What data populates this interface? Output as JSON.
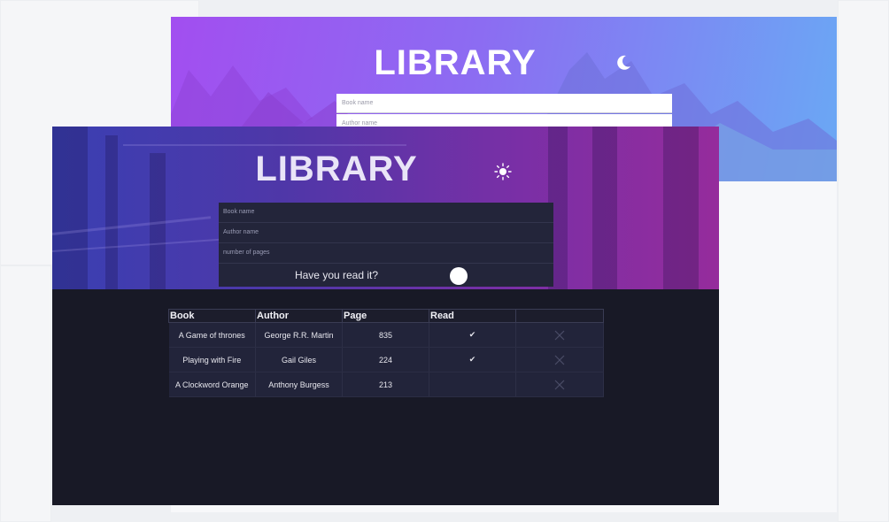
{
  "back_window": {
    "title": "LIBRARY",
    "theme_icon": "moon-icon",
    "fields": {
      "book_placeholder": "Book name",
      "author_placeholder": "Author name"
    }
  },
  "front_window": {
    "title": "LIBRARY",
    "theme_icon": "sun-icon",
    "form": {
      "book_placeholder": "Book name",
      "author_placeholder": "Author name",
      "pages_placeholder": "number of pages",
      "read_label": "Have you read it?"
    },
    "table": {
      "headers": [
        "Book",
        "Author",
        "Page",
        "Read",
        ""
      ],
      "rows": [
        {
          "book": "A Game of thrones",
          "author": "George R.R. Martin",
          "pages": "835",
          "read": "✔"
        },
        {
          "book": "Playing with Fire",
          "author": "Gail Giles",
          "pages": "224",
          "read": "✔"
        },
        {
          "book": "A Clockword Orange",
          "author": "Anthony Burgess",
          "pages": "213",
          "read": ""
        }
      ]
    }
  },
  "colors": {
    "light_header_start": "#a24ef0",
    "light_header_end": "#6aa8f4",
    "dark_header_start": "#3a3fb2",
    "dark_header_end": "#952c9c",
    "dark_background": "#181926",
    "dark_panel": "#23253a"
  }
}
